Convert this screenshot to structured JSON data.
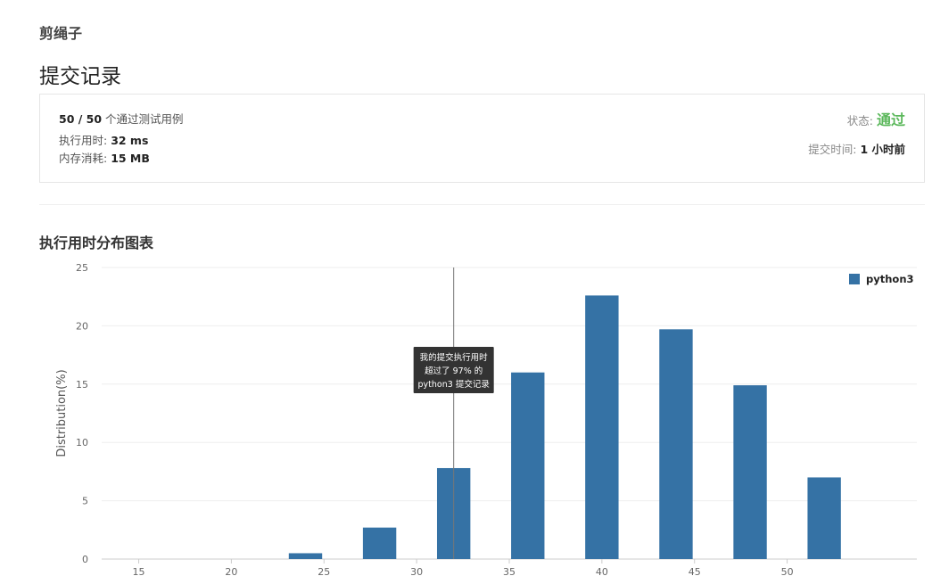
{
  "problem": {
    "title": "剪绳子"
  },
  "page": {
    "heading": "提交记录"
  },
  "result": {
    "passed": "50 / 50",
    "passed_suffix": " 个通过测试用例",
    "runtime_label": "执行用时: ",
    "runtime_value": "32 ms",
    "memory_label": "内存消耗: ",
    "memory_value": "15 MB",
    "status_label": "状态: ",
    "status_value": "通过",
    "submit_time_label": "提交时间: ",
    "submit_time_value": "1 小时前"
  },
  "chart_section": {
    "title": "执行用时分布图表"
  },
  "colors": {
    "bar": "#3572a5",
    "accepted": "#5cb85c"
  },
  "chart_data": {
    "type": "bar",
    "ylabel": "Distribution(%)",
    "xlim": [
      13,
      57
    ],
    "ylim": [
      0,
      25
    ],
    "x_ticks": [
      15,
      20,
      25,
      30,
      35,
      40,
      45,
      50
    ],
    "y_ticks": [
      0,
      5,
      10,
      15,
      20,
      25
    ],
    "series": [
      {
        "name": "python3",
        "x": [
          24,
          28,
          32,
          36,
          40,
          44,
          48,
          52
        ],
        "values": [
          0.5,
          2.7,
          7.8,
          16.0,
          22.6,
          19.7,
          14.9,
          7.0
        ]
      }
    ],
    "bar_width": 1.8,
    "marker": {
      "x": 32,
      "lines": [
        "我的提交执行用时",
        "超过了 97% 的",
        "python3 提交记录"
      ]
    },
    "legend_position": "top-right",
    "grid": true
  }
}
